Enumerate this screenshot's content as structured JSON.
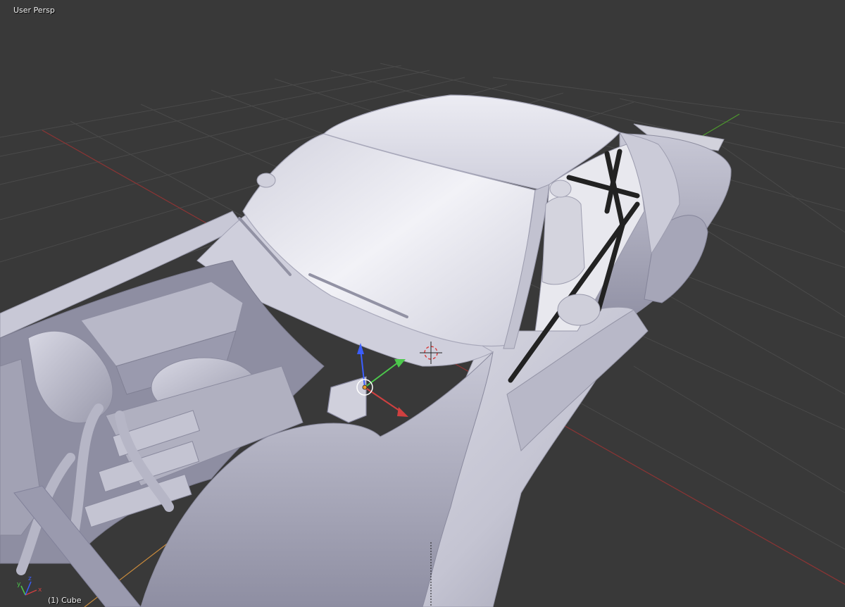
{
  "viewport": {
    "view_label": "User Persp",
    "object_label": "(1) Cube"
  },
  "icons": {
    "transform_gizmo": "translate-manipulator-icon",
    "cursor_3d": "3d-cursor-icon",
    "axis_orientation": "axis-orientation-icon"
  },
  "colors": {
    "background": "#393939",
    "grid": "#4a4a4a",
    "x_axis": "#c84040",
    "y_axis": "#4cc84c",
    "z_axis": "#3b5eff",
    "model": "#c5c5d3",
    "roll_cage": "#222222"
  }
}
